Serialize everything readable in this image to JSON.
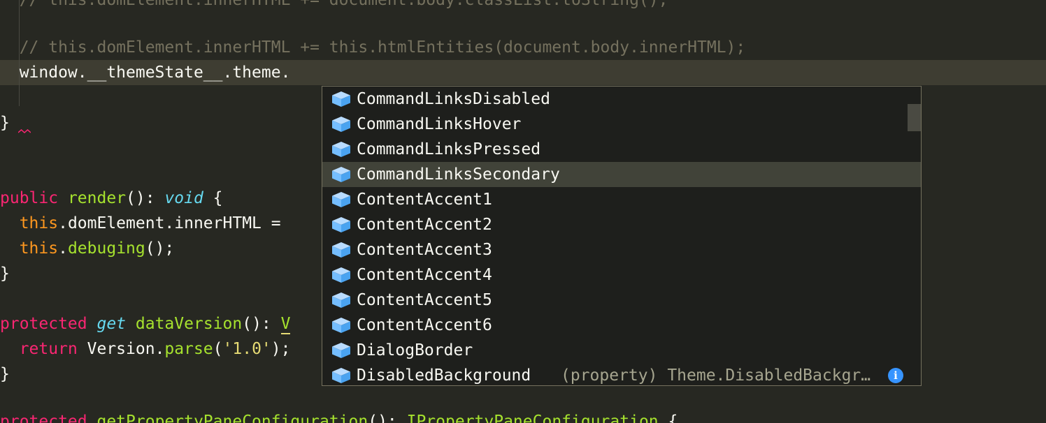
{
  "editor": {
    "lines": [
      {
        "id": "l0",
        "tokens": [
          {
            "t": "  // this.domElement.innerHTML += document.body.classList.toString();",
            "c": "comment"
          }
        ]
      },
      {
        "id": "l1",
        "tokens": [
          {
            "t": "  // this.domElement.innerHTML += this.htmlEntities(document.body.innerHTML);",
            "c": "comment"
          }
        ]
      },
      {
        "id": "l2",
        "tokens": [
          {
            "t": "  window.__themeState__.theme.",
            "c": "punc"
          }
        ]
      },
      {
        "id": "l3",
        "tokens": [
          {
            "t": "}",
            "c": "punc"
          }
        ]
      },
      {
        "id": "l4",
        "tokens": [
          {
            "t": "public",
            "c": "kw"
          },
          {
            "t": " ",
            "c": "punc"
          },
          {
            "t": "render",
            "c": "fn"
          },
          {
            "t": "(): ",
            "c": "punc"
          },
          {
            "t": "void",
            "c": "type"
          },
          {
            "t": " {",
            "c": "punc"
          }
        ]
      },
      {
        "id": "l5",
        "tokens": [
          {
            "t": "  ",
            "c": "punc"
          },
          {
            "t": "this",
            "c": "this"
          },
          {
            "t": ".domElement.innerHTML = ",
            "c": "punc"
          }
        ]
      },
      {
        "id": "l6",
        "tokens": [
          {
            "t": "  ",
            "c": "punc"
          },
          {
            "t": "this",
            "c": "this"
          },
          {
            "t": ".",
            "c": "punc"
          },
          {
            "t": "debuging",
            "c": "fn"
          },
          {
            "t": "();",
            "c": "punc"
          }
        ]
      },
      {
        "id": "l7",
        "tokens": [
          {
            "t": "}",
            "c": "punc"
          }
        ]
      },
      {
        "id": "l8",
        "tokens": [
          {
            "t": "protected",
            "c": "kw"
          },
          {
            "t": " ",
            "c": "punc"
          },
          {
            "t": "get",
            "c": "type"
          },
          {
            "t": " ",
            "c": "punc"
          },
          {
            "t": "dataVersion",
            "c": "fn"
          },
          {
            "t": "(): ",
            "c": "punc"
          },
          {
            "t": "V",
            "c": "fn",
            "u": true
          }
        ]
      },
      {
        "id": "l9",
        "tokens": [
          {
            "t": "  ",
            "c": "punc"
          },
          {
            "t": "return",
            "c": "kw"
          },
          {
            "t": " Version.",
            "c": "punc"
          },
          {
            "t": "parse",
            "c": "fn"
          },
          {
            "t": "(",
            "c": "punc"
          },
          {
            "t": "'1.0'",
            "c": "str"
          },
          {
            "t": ");",
            "c": "punc"
          }
        ]
      },
      {
        "id": "l10",
        "tokens": [
          {
            "t": "}",
            "c": "punc"
          }
        ]
      },
      {
        "id": "l11",
        "tokens": [
          {
            "t": "protected",
            "c": "kw"
          },
          {
            "t": " ",
            "c": "punc"
          },
          {
            "t": "getPropertyPaneConfiguration",
            "c": "fn"
          },
          {
            "t": "(): ",
            "c": "punc"
          },
          {
            "t": "IPropertyPaneConfiguration",
            "c": "fn"
          },
          {
            "t": " {",
            "c": "punc"
          }
        ]
      }
    ]
  },
  "suggest": {
    "items": [
      {
        "label": "CommandLinksDisabled",
        "icon": "property-cube-icon"
      },
      {
        "label": "CommandLinksHover",
        "icon": "property-cube-icon"
      },
      {
        "label": "CommandLinksPressed",
        "icon": "property-cube-icon"
      },
      {
        "label": "CommandLinksSecondary",
        "icon": "property-cube-icon",
        "selected": true
      },
      {
        "label": "ContentAccent1",
        "icon": "property-cube-icon"
      },
      {
        "label": "ContentAccent2",
        "icon": "property-cube-icon"
      },
      {
        "label": "ContentAccent3",
        "icon": "property-cube-icon"
      },
      {
        "label": "ContentAccent4",
        "icon": "property-cube-icon"
      },
      {
        "label": "ContentAccent5",
        "icon": "property-cube-icon"
      },
      {
        "label": "ContentAccent6",
        "icon": "property-cube-icon"
      },
      {
        "label": "DialogBorder",
        "icon": "property-cube-icon"
      },
      {
        "label": "DisabledBackground",
        "icon": "property-cube-icon",
        "detail": "(property) Theme.DisabledBackgr…",
        "info": "i"
      }
    ]
  },
  "colors": {
    "background": "#272822",
    "current_line": "#3e3d32",
    "comment": "#75715e",
    "keyword": "#f92672",
    "function": "#a6e22e",
    "this": "#fd971f",
    "type": "#66d9ef",
    "string": "#e6db74",
    "icon": "#75beff",
    "info": "#3794ff"
  }
}
